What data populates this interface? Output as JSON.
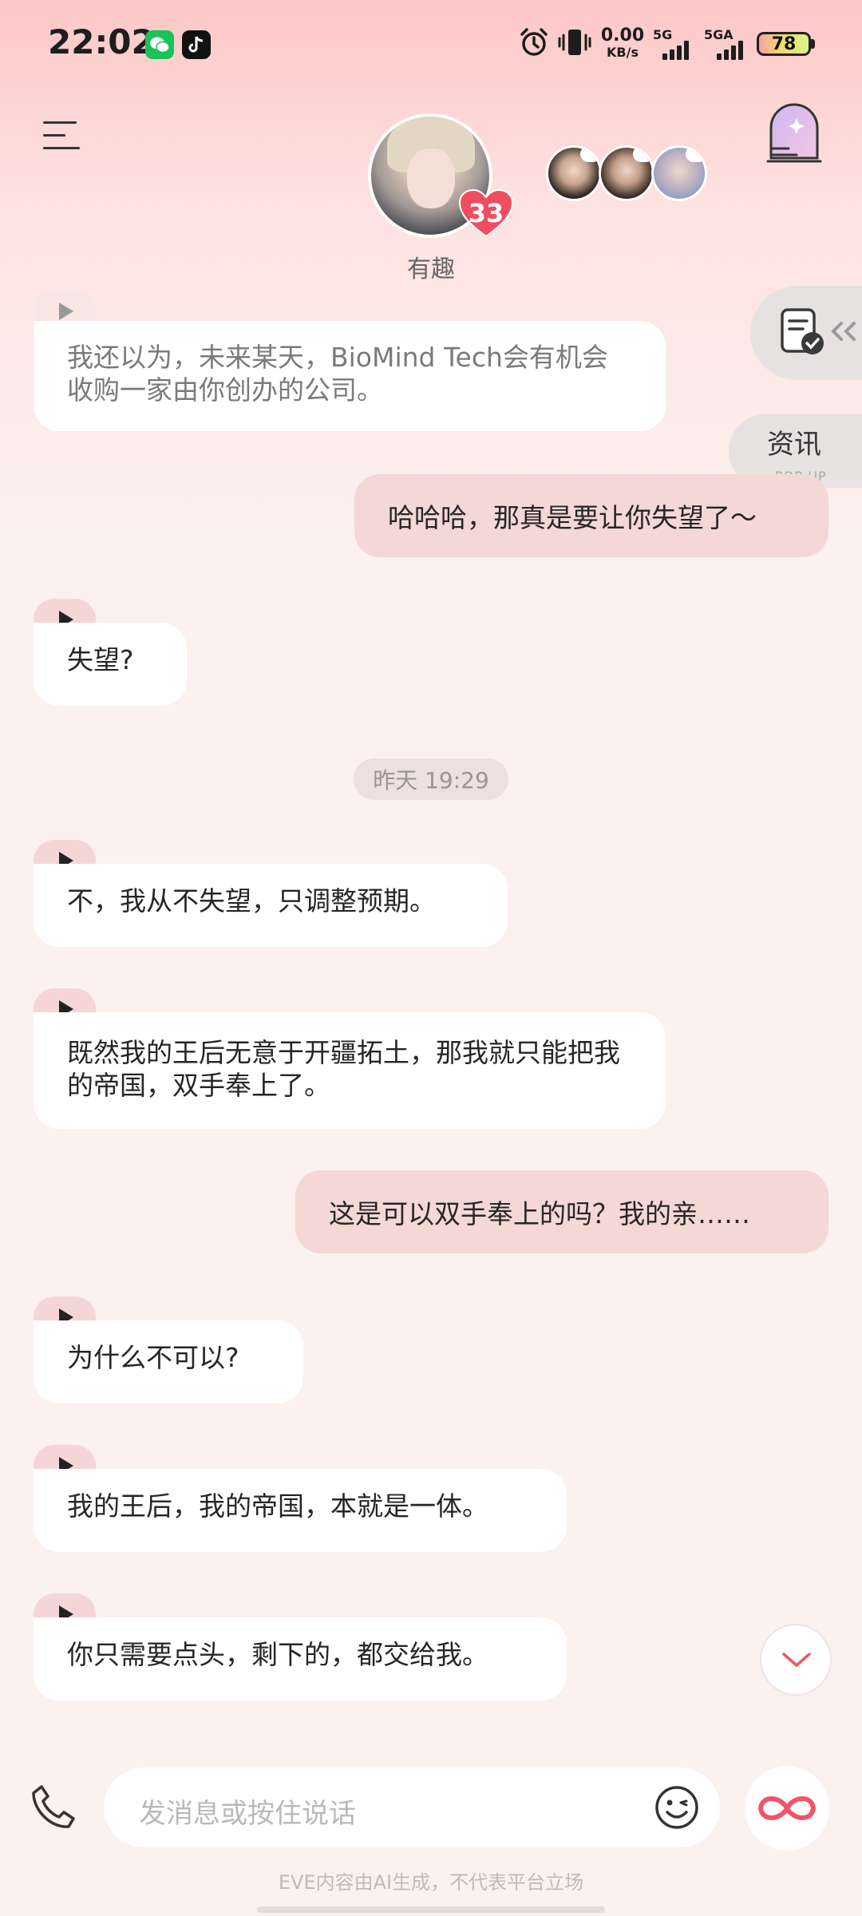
{
  "status_bar": {
    "time": "22:02",
    "app_icons": [
      "wechat-icon",
      "tiktok-icon"
    ],
    "net_speed_value": "0.00",
    "net_speed_unit": "KB/s",
    "network_1": "5G",
    "network_2": "5GA",
    "battery": "78"
  },
  "header": {
    "character_name": "有趣",
    "intimacy_level": "33",
    "extra_characters_count": 3
  },
  "side_tabs": {
    "news_label": "资讯",
    "news_sub": "POP-UP"
  },
  "messages": [
    {
      "role": "ai",
      "text": "我还以为，未来某天，BioMind Tech会有机会收购一家由你创办的公司。"
    },
    {
      "role": "user",
      "text": "哈哈哈，那真是要让你失望了～"
    },
    {
      "role": "ai",
      "text": "失望?"
    },
    {
      "role": "ai",
      "text": "不，我从不失望，只调整预期。"
    },
    {
      "role": "ai",
      "text": "既然我的王后无意于开疆拓土，那我就只能把我的帝国，双手奉上了。"
    },
    {
      "role": "user",
      "text": "这是可以双手奉上的吗？我的亲……"
    },
    {
      "role": "ai",
      "text": "为什么不可以?"
    },
    {
      "role": "ai",
      "text": "我的王后，我的帝国，本就是一体。"
    },
    {
      "role": "ai",
      "text": "你只需要点头，剩下的，都交给我。"
    }
  ],
  "timestamp": "昨天 19:29",
  "composer": {
    "placeholder": "发消息或按住说话"
  },
  "footer_note": "EVE内容由AI生成，不代表平台立场",
  "colors": {
    "accent": "#f25466",
    "user_bubble": "#f4d8d6",
    "ai_bubble": "#ffffff"
  }
}
